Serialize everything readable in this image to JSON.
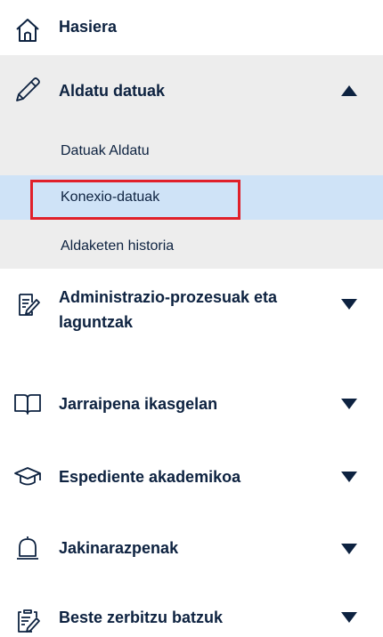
{
  "menu": {
    "items": [
      {
        "label": "Hasiera",
        "icon": "home-icon"
      },
      {
        "label": "Aldatu datuak",
        "icon": "pencil-icon",
        "expanded": true,
        "sub_items": [
          {
            "label": "Datuak Aldatu"
          },
          {
            "label": "Konexio-datuak",
            "active": true,
            "highlighted": true
          },
          {
            "label": "Aldaketen historia"
          }
        ]
      },
      {
        "label": "Administrazio-prozesuak eta laguntzak",
        "icon": "document-edit-icon"
      },
      {
        "label": "Jarraipena ikasgelan",
        "icon": "book-icon"
      },
      {
        "label": "Espediente akademikoa",
        "icon": "graduation-cap-icon"
      },
      {
        "label": "Jakinarazpenak",
        "icon": "bell-icon"
      },
      {
        "label": "Beste zerbitzu batzuk",
        "icon": "clipboard-edit-icon"
      }
    ]
  },
  "colors": {
    "text": "#0d2240",
    "expanded_bg": "#ededed",
    "active_bg": "#cfe3f7",
    "highlight_border": "#e0202a"
  }
}
